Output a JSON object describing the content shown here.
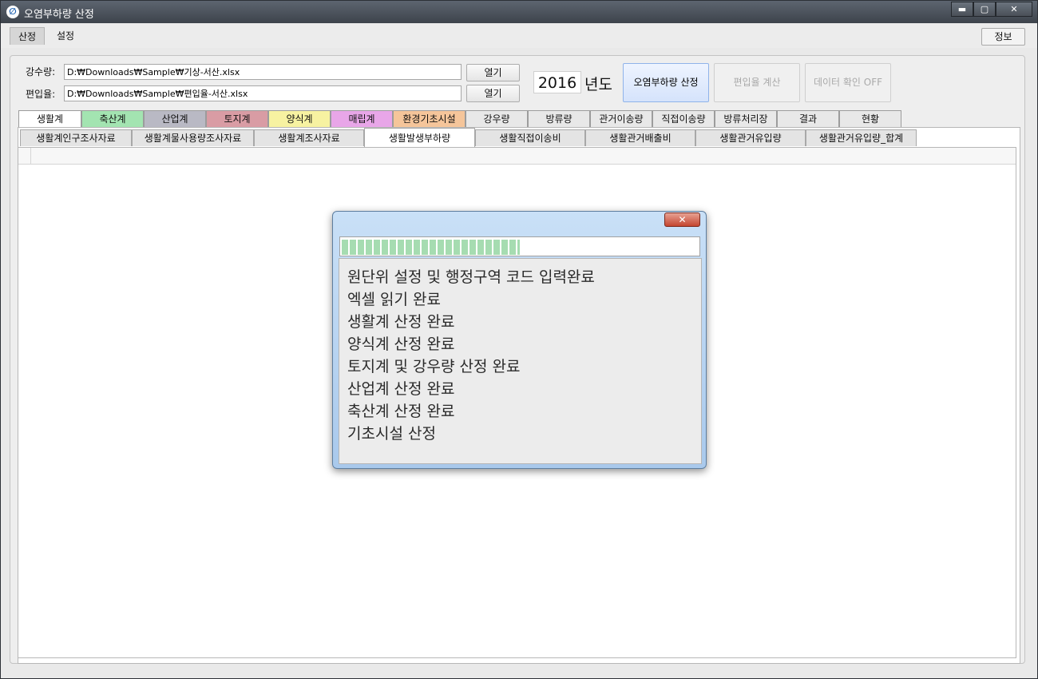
{
  "window": {
    "title": "오염부하량 산정"
  },
  "window_controls": {
    "minimize": "▬",
    "maximize": "▢",
    "close": "✕"
  },
  "menu": {
    "items": [
      "산정",
      "설정"
    ],
    "info": "정보"
  },
  "fields": {
    "rain_label": "강수량:",
    "rain_path": "D:₩Downloads₩Sample₩기상-서산.xlsx",
    "incorp_label": "편입율:",
    "incorp_path": "D:₩Downloads₩Sample₩편입율-서산.xlsx",
    "open1": "열기",
    "open2": "열기"
  },
  "year": {
    "value": "2016",
    "suffix": "년도"
  },
  "actions": {
    "calc_load": "오염부하량 산정",
    "calc_rate": "편입율 계산",
    "data_check": "데이터 확인 OFF"
  },
  "tabs_main": [
    {
      "label": "생활계",
      "color": "#ffffff"
    },
    {
      "label": "축산계",
      "color": "#a3e4b1"
    },
    {
      "label": "산업계",
      "color": "#b9b9c4"
    },
    {
      "label": "토지계",
      "color": "#d99ca4"
    },
    {
      "label": "양식계",
      "color": "#f7f2a1"
    },
    {
      "label": "매립계",
      "color": "#e8a6e8"
    },
    {
      "label": "환경기초시설",
      "color": "#f5c59a"
    },
    {
      "label": "강우량",
      "color": "#e8e8e8"
    },
    {
      "label": "방류량",
      "color": "#e8e8e8"
    },
    {
      "label": "관거이송량",
      "color": "#e8e8e8"
    },
    {
      "label": "직접이송량",
      "color": "#e8e8e8"
    },
    {
      "label": "방류처리장",
      "color": "#e8e8e8"
    },
    {
      "label": "결과",
      "color": "#e8e8e8"
    },
    {
      "label": "현황",
      "color": "#e8e8e8"
    }
  ],
  "tabs_sub": [
    "생활계인구조사자료",
    "생활계물사용량조사자료",
    "생활계조사자료",
    "생활발생부하량",
    "생활직접이송비",
    "생활관거배출비",
    "생활관거유입량",
    "생활관거유입량_합계"
  ],
  "active_sub_tab": "생활발생부하량",
  "dialog": {
    "close": "✕",
    "progress": 0.5,
    "log": [
      "원단위 설정 및 행정구역 코드 입력완료",
      "엑셀 읽기 완료",
      "생활계 산정 완료",
      "양식계 산정 완료",
      "토지계 및 강우량 산정 완료",
      "산업계 산정 완료",
      "축산계 산정 완료",
      "기초시설 산정"
    ]
  }
}
